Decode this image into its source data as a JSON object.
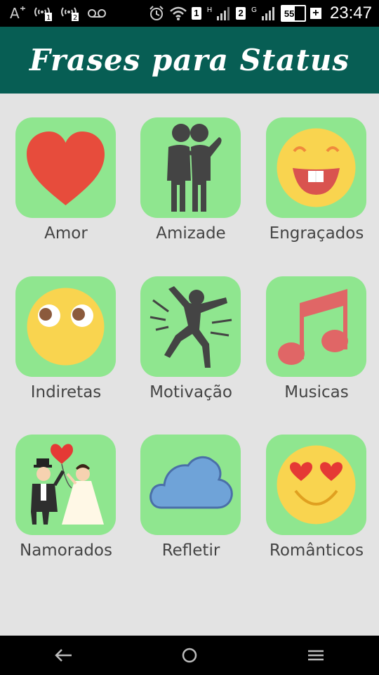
{
  "status_bar": {
    "sim1": "1",
    "sim1_net": "H",
    "sim2": "2",
    "sim2_net": "G",
    "battery_level": "55%",
    "battery_fraction": 0.55,
    "time": "23:47",
    "icons": [
      "font-size-icon",
      "hotspot-1-icon",
      "hotspot-2-icon",
      "voicemail-icon",
      "alarm-icon",
      "wifi-icon",
      "signal-icon",
      "battery-icon",
      "charging-icon"
    ]
  },
  "app_bar": {
    "title": "Frases para Status"
  },
  "categories": [
    {
      "label": "Amor",
      "icon": "heart-icon"
    },
    {
      "label": "Amizade",
      "icon": "friends-icon"
    },
    {
      "label": "Engraçados",
      "icon": "laughing-face-icon"
    },
    {
      "label": "Indiretas",
      "icon": "side-eye-face-icon"
    },
    {
      "label": "Motivação",
      "icon": "jumping-person-icon"
    },
    {
      "label": "Musicas",
      "icon": "music-note-icon"
    },
    {
      "label": "Namorados",
      "icon": "wedding-couple-icon"
    },
    {
      "label": "Refletir",
      "icon": "cloud-icon"
    },
    {
      "label": "Românticos",
      "icon": "heart-eyes-face-icon"
    }
  ],
  "nav_bar": {
    "icons": [
      "back-icon",
      "home-icon",
      "menu-icon"
    ]
  },
  "colors": {
    "app_bar": "#075e54",
    "tile": "#8fe68f",
    "background": "#e3e3e3"
  }
}
